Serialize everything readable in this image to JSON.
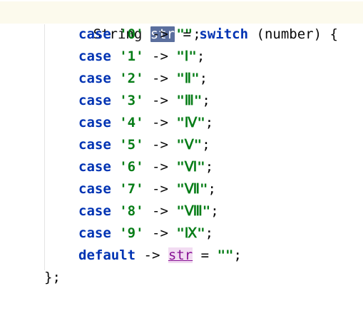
{
  "editor": {
    "line1": {
      "type": "String",
      "var": "str",
      "eq": "=",
      "kw_switch": "switch",
      "expr": "(number)",
      "brace": "{"
    },
    "cases": [
      {
        "kw": "case",
        "label": "'0'",
        "arrow": "->",
        "value": "\"\"",
        "semi": ";"
      },
      {
        "kw": "case",
        "label": "'1'",
        "arrow": "->",
        "value": "\"Ⅰ\"",
        "semi": ";"
      },
      {
        "kw": "case",
        "label": "'2'",
        "arrow": "->",
        "value": "\"Ⅱ\"",
        "semi": ";"
      },
      {
        "kw": "case",
        "label": "'3'",
        "arrow": "->",
        "value": "\"Ⅲ\"",
        "semi": ";"
      },
      {
        "kw": "case",
        "label": "'4'",
        "arrow": "->",
        "value": "\"Ⅳ\"",
        "semi": ";"
      },
      {
        "kw": "case",
        "label": "'5'",
        "arrow": "->",
        "value": "\"Ⅴ\"",
        "semi": ";"
      },
      {
        "kw": "case",
        "label": "'6'",
        "arrow": "->",
        "value": "\"Ⅵ\"",
        "semi": ";"
      },
      {
        "kw": "case",
        "label": "'7'",
        "arrow": "->",
        "value": "\"Ⅶ\"",
        "semi": ";"
      },
      {
        "kw": "case",
        "label": "'8'",
        "arrow": "->",
        "value": "\"Ⅷ\"",
        "semi": ";"
      },
      {
        "kw": "case",
        "label": "'9'",
        "arrow": "->",
        "value": "\"Ⅸ\"",
        "semi": ";"
      }
    ],
    "default_line": {
      "kw": "default",
      "arrow": "->",
      "var": "str",
      "eq": "=",
      "value": "\"\"",
      "semi": ";"
    },
    "closing": "};"
  },
  "colors": {
    "keyword": "#0033b3",
    "string": "#067d17",
    "selection": "#5b6f9e",
    "usage_highlight": "#f2dcf2",
    "current_line": "#fcfaed"
  }
}
